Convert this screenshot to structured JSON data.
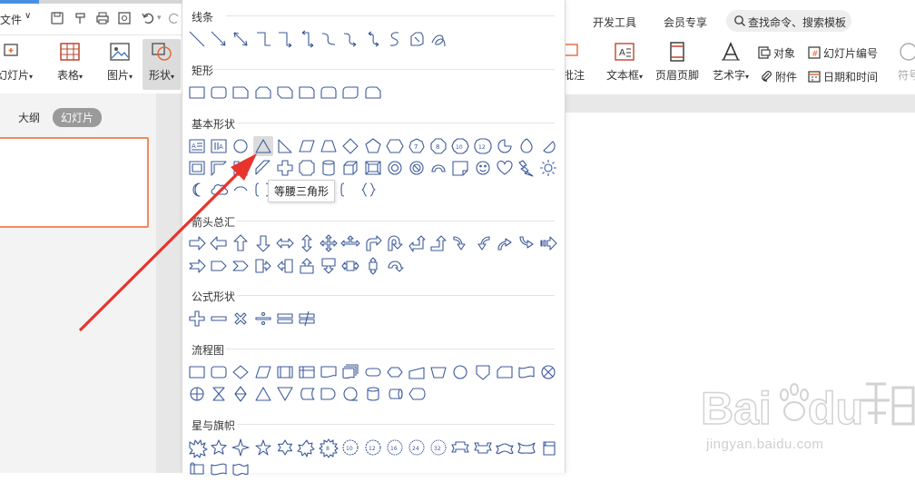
{
  "topbar": {
    "file_label": "文件"
  },
  "ribbon_left": {
    "new_slide": "幻灯片",
    "table": "表格",
    "picture": "图片",
    "shape": "形状"
  },
  "left_pane": {
    "tab_outline": "大纲",
    "tab_slides": "幻灯片"
  },
  "topbar_right": {
    "dev_tools": "开发工具",
    "member": "会员专享",
    "search_placeholder": "查找命令、搜索模板"
  },
  "ribbon_right": {
    "annotation": "批注",
    "textbox": "文本框",
    "header_footer": "页眉页脚",
    "wordart": "艺术字",
    "object": "对象",
    "slide_number": "幻灯片编号",
    "attachment": "附件",
    "datetime": "日期和时间",
    "symbol": "符号"
  },
  "menu": {
    "sections": {
      "lines": "线条",
      "rect": "矩形",
      "basic": "基本形状",
      "arrows": "箭头总汇",
      "equation": "公式形状",
      "flowchart": "流程图",
      "stars": "星与旗帜"
    },
    "tooltip": "等腰三角形"
  },
  "watermark": {
    "url": "jingyan.baidu.com"
  },
  "colors": {
    "accent_blue": "#4a90e2",
    "shape_stroke": "#3c5a9a",
    "arrow_red": "#e8342c",
    "thumb_border": "#f08a5d"
  }
}
